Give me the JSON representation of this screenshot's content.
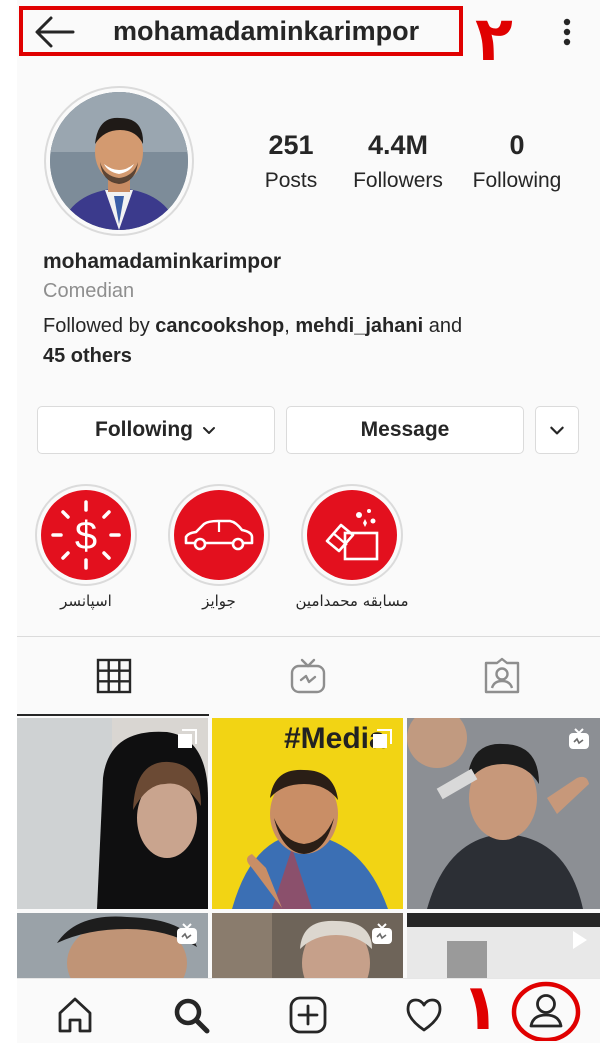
{
  "header": {
    "username": "mohamadaminkarimpor",
    "annotation_2": "۲",
    "annotation_1": "۱",
    "annotation_color": "#e00000"
  },
  "stats": [
    {
      "value": "251",
      "label": "Posts"
    },
    {
      "value": "4.4M",
      "label": "Followers"
    },
    {
      "value": "0",
      "label": "Following"
    }
  ],
  "bio": {
    "name": "mohamadaminkarimpor",
    "category": "Comedian",
    "followed_by_prefix": "Followed by ",
    "follower_1": "cancookshop",
    "separator": ", ",
    "follower_2": "mehdi_jahani",
    "and_text": " and",
    "others": "45 others"
  },
  "actions": {
    "following_label": "Following",
    "message_label": "Message"
  },
  "highlights": [
    {
      "label": "اسپانسر",
      "icon": "dollar-icon"
    },
    {
      "label": "جوایز",
      "icon": "car-icon"
    },
    {
      "label": "مسابقه محمدامین",
      "icon": "gift-icon"
    }
  ],
  "tabs": [
    {
      "name": "grid",
      "icon": "grid-icon",
      "active": true
    },
    {
      "name": "igtv",
      "icon": "igtv-icon",
      "active": false
    },
    {
      "name": "tagged",
      "icon": "tagged-icon",
      "active": false
    }
  ],
  "posts": [
    {
      "icon": "multi-post-icon"
    },
    {
      "icon": "multi-post-icon"
    },
    {
      "icon": "igtv-icon"
    },
    {
      "icon": "igtv-icon"
    },
    {
      "icon": "igtv-icon"
    },
    {
      "icon": "play-icon"
    }
  ],
  "nav": [
    {
      "icon": "home-icon"
    },
    {
      "icon": "search-icon"
    },
    {
      "icon": "new-post-icon"
    },
    {
      "icon": "heart-icon"
    },
    {
      "icon": "profile-icon"
    }
  ],
  "colors": {
    "highlight_red": "#e3101e",
    "text": "#262626",
    "muted": "#8e8e8e",
    "border": "#dbdbdb"
  }
}
